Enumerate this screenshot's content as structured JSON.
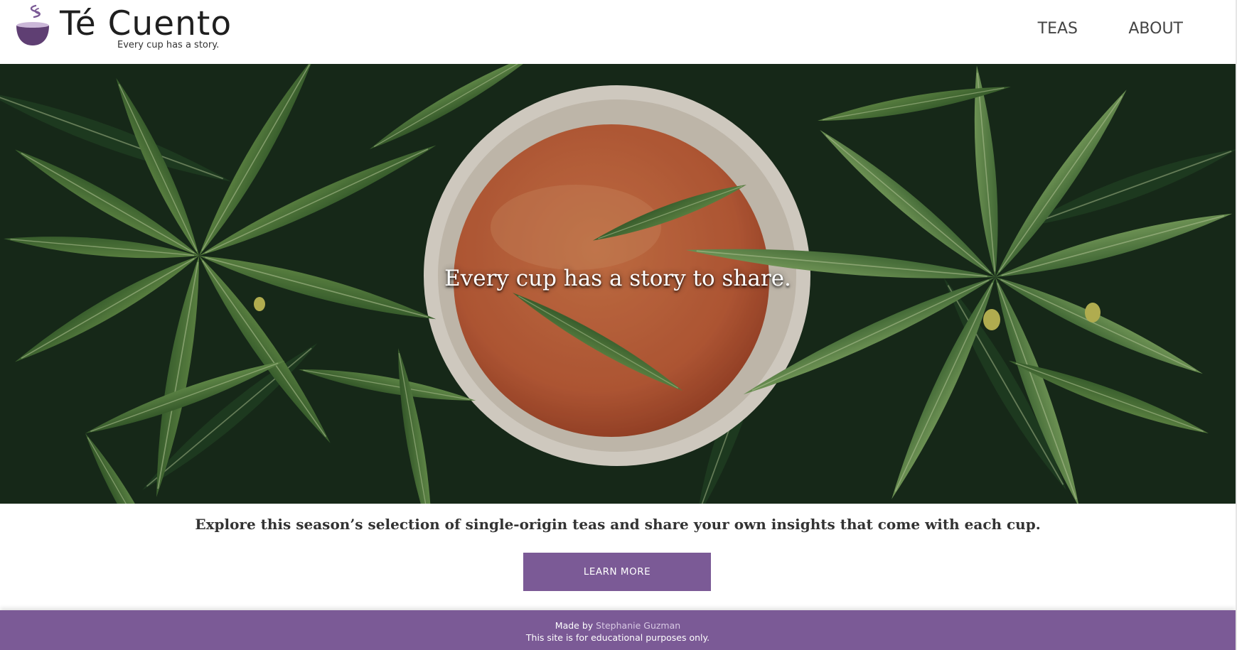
{
  "brand": {
    "name": "Té Cuento",
    "tagline": "Every cup has a story.",
    "logo_icon": "tea-bowl-icon",
    "colors": {
      "accent": "#7b5a96",
      "logo_bowl": "#5f3f73"
    }
  },
  "nav": {
    "items": [
      {
        "label": "TEAS"
      },
      {
        "label": "ABOUT"
      }
    ]
  },
  "hero": {
    "heading": "Every cup has a story to share.",
    "image": "tea-cup-among-green-leaves"
  },
  "intro": {
    "text": "Explore this season’s selection of single-origin teas and share your own insights that come with each cup."
  },
  "cta": {
    "label": "LEARN MORE"
  },
  "footer": {
    "made_by_prefix": "Made by ",
    "author": "Stephanie Guzman",
    "disclaimer": "This site is for educational purposes only."
  }
}
